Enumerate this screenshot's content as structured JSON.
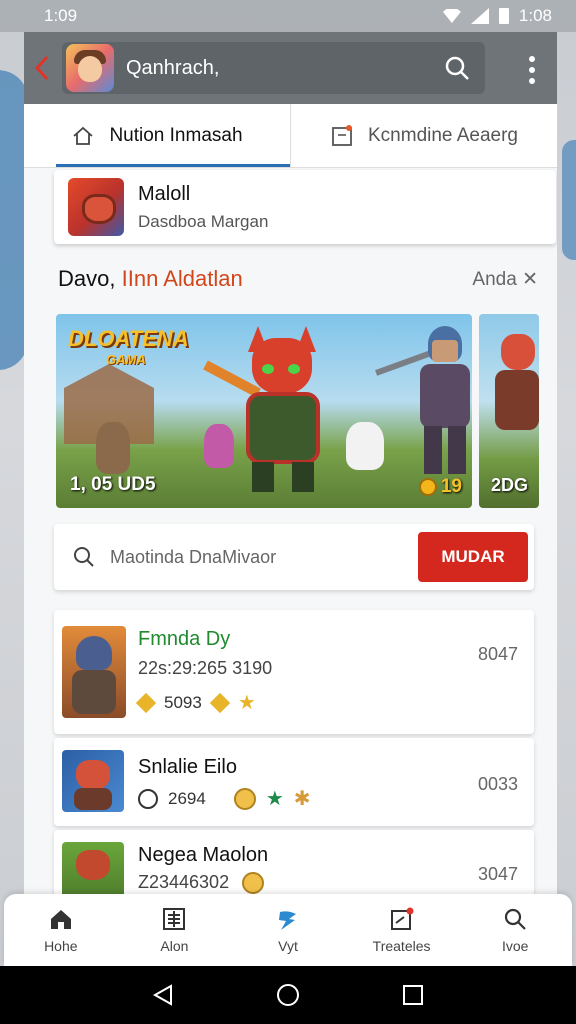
{
  "status_bar": {
    "time_left": "1:09",
    "time_right": "1:08"
  },
  "app_bar": {
    "title": "Qanhrach,",
    "back_icon": "chevron-left-icon",
    "search_icon": "search-icon",
    "menu_icon": "more-vert-icon"
  },
  "tabs": [
    {
      "label": "Nution Inmasah",
      "icon": "home-icon",
      "active": true
    },
    {
      "label": "Kcnmdine  Aeaerg",
      "icon": "notice-icon",
      "active": false
    }
  ],
  "account": {
    "name": "Maloll",
    "subtitle": "Dasdboa Margan"
  },
  "section": {
    "title_part1": "Davo,",
    "title_part2": "IInn Aldatlan",
    "more": "Anda"
  },
  "banner": {
    "logo": "DLOATENA",
    "logo_sub": "GAMA",
    "count": "1, 05 UD5",
    "score": "19",
    "next_count": "2DG"
  },
  "search": {
    "placeholder": "Maotinda DnaMivaor",
    "button": "MUDAR"
  },
  "games": [
    {
      "name": "Fmnda Dy",
      "subtitle": "22s:29:265 3190",
      "value": "5093",
      "number": "8047"
    },
    {
      "name": "Snlalie Eilo",
      "value": "2694",
      "number": "0033"
    },
    {
      "name": "Negea Maolon",
      "subtitle": "Z23446302",
      "number": "3047"
    }
  ],
  "bottom_nav": [
    {
      "label": "Hohe",
      "icon": "home-icon"
    },
    {
      "label": "Alon",
      "icon": "list-icon"
    },
    {
      "label": "Vyt",
      "icon": "bolt-icon"
    },
    {
      "label": "Treateles",
      "icon": "notice-icon"
    },
    {
      "label": "Ivoe",
      "icon": "search-icon"
    }
  ],
  "colors": {
    "accent": "#d4281f",
    "tab_indicator": "#2a6fb5",
    "section_highlight": "#d2461b",
    "game_name_green": "#1f8a2e",
    "app_bar": "#6f7479"
  }
}
